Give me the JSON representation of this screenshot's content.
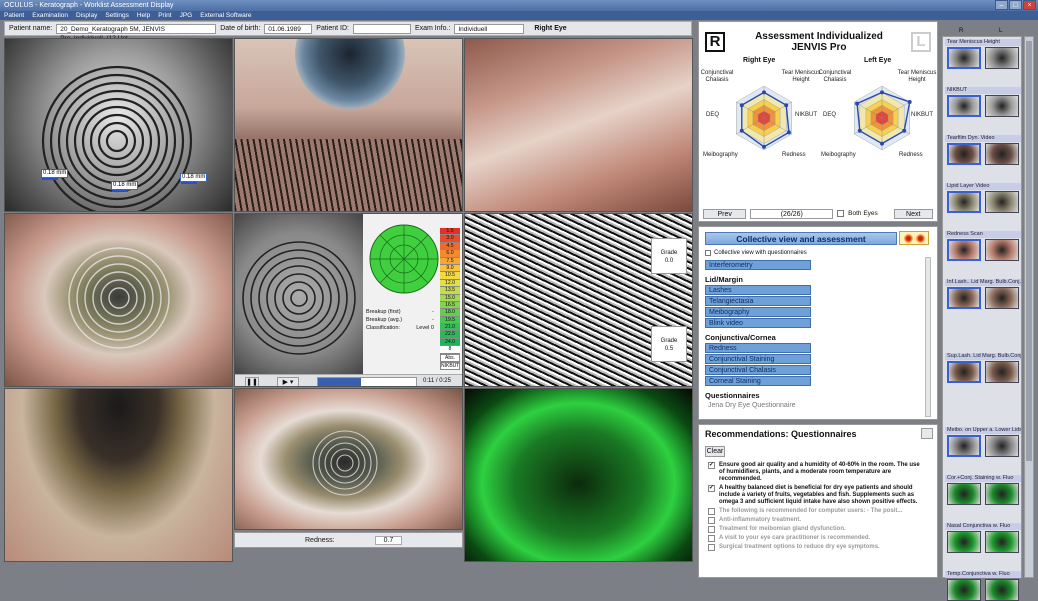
{
  "window": {
    "title": "OCULUS - Keratograph - Worklist Assessment Display"
  },
  "menu": [
    "Patient",
    "Examination",
    "Display",
    "Settings",
    "Help",
    "Print",
    "JPG",
    "External Software"
  ],
  "patient": {
    "name_label": "Patient name:",
    "name_value": "20_Demo_Keratograph 5M, JENVIS Pro_Individuell_(12 Unt",
    "dob_label": "Date of birth:",
    "dob_value": "01.06.1989",
    "id_label": "Patient ID:",
    "id_value": "",
    "exam_label": "Exam Info.:",
    "exam_value": "Individuell",
    "eye": "Right Eye"
  },
  "measurements": [
    "0.18 mm",
    "0.18 mm",
    "0.18 mm"
  ],
  "breakup": {
    "first_label": "Breakup (first)",
    "first_value": "-",
    "avg_label": "Breakup (avg.)",
    "avg_value": "-",
    "class_label": "Classification:",
    "class_value": "Level 0",
    "time": "0:11 / 0:25",
    "scale": [
      "1.5",
      "3.0",
      "4.5",
      "6.0",
      "7.5",
      "9.0",
      "10.5",
      "12.0",
      "13.5",
      "15.0",
      "16.5",
      "18.0",
      "19.5",
      "21.0",
      "22.5",
      "24.0",
      "8"
    ],
    "abs": "Abs.",
    "nikbut": "NIKBUT"
  },
  "grades": [
    {
      "label": "Grade",
      "value": "0.0"
    },
    {
      "label": "Grade",
      "value": "0.5"
    }
  ],
  "redness": {
    "label": "Redness:",
    "value": "0.7"
  },
  "assessment": {
    "title1": "Assessment Individualized",
    "title2": "JENVIS Pro",
    "badge_r": "R",
    "badge_l": "L",
    "right": "Right Eye",
    "left": "Left Eye",
    "axes": [
      "Conjunctival Chalasis",
      "Tear Meniscus Height",
      "DEQ",
      "NIKBUT",
      "Meibography",
      "Redness"
    ],
    "prev": "Prev",
    "counter": "(26/26)",
    "both": "Both Eyes",
    "next": "Next"
  },
  "collective": {
    "title": "Collective view and assessment",
    "with_q": "Collective view with questionnaires",
    "interfero": "Interferometry",
    "sections": [
      {
        "title": "Lid/Margin",
        "items": [
          "Lashes",
          "Telangiectasia",
          "Meibography",
          "Blink video"
        ]
      },
      {
        "title": "Conjunctiva/Cornea",
        "items": [
          "Redness",
          "Conjunctival Staining",
          "Conjunctival Chalasis",
          "Corneal Staining"
        ]
      },
      {
        "title": "Questionnaires",
        "items": [
          "Jena Dry Eye Questionnaire"
        ]
      }
    ]
  },
  "recommendations": {
    "title": "Recommendations: Questionnaires",
    "clear": "Clear",
    "items": [
      {
        "checked": true,
        "text": "Ensure good air quality and a humidity of 40-60% in the room. The use of humidifiers, plants, and a moderate room temperature are recommended."
      },
      {
        "checked": true,
        "text": "A healthy balanced diet is beneficial for dry eye patients and should include a variety of fruits, vegetables and fish. Supplements such as omega 3 and sufficient liquid intake have also shown positive effects."
      },
      {
        "checked": false,
        "text": "The following is recommended for computer users: - The posit..."
      },
      {
        "checked": false,
        "text": "Anti-inflammatory treatment."
      },
      {
        "checked": false,
        "text": "Treatment for meibomian gland dysfunction."
      },
      {
        "checked": false,
        "text": "A visit to your eye care practitioner is recommended."
      },
      {
        "checked": false,
        "text": "Surgical treatment options to reduce dry eye symptoms."
      }
    ]
  },
  "thumbs": {
    "r": "R",
    "l": "L",
    "labels": [
      "Tear Meniscus Height",
      "NIKBUT",
      "Tearfilm Dyn. Video",
      "Lipid Layer Video",
      "Redness Scan",
      "Inf.Lash.. Lid Marg. Bulb.Conj.",
      "Sup.Lash. Lid Marg. Bulb.Conj.",
      "Meibo. on Upper a. Lower Lids",
      "Cor.+Conj. Staining w. Fluo",
      "Nasal Conjunctiva w. Fluo",
      "Temp.Conjunctiva w. Fluo"
    ]
  }
}
